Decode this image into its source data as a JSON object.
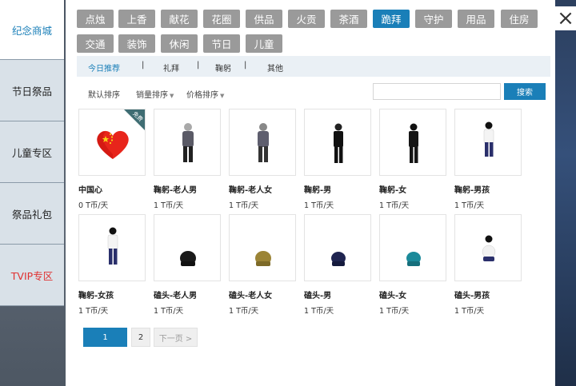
{
  "side_nav": [
    {
      "label": "纪念商城",
      "active": true
    },
    {
      "label": "节日祭品"
    },
    {
      "label": "儿童专区"
    },
    {
      "label": "祭品礼包"
    },
    {
      "label": "TVIP专区",
      "vip": true
    }
  ],
  "categories": [
    {
      "label": "点烛"
    },
    {
      "label": "上香"
    },
    {
      "label": "献花"
    },
    {
      "label": "花圈"
    },
    {
      "label": "供品"
    },
    {
      "label": "火贡"
    },
    {
      "label": "茶酒"
    },
    {
      "label": "跪拜",
      "active": true
    },
    {
      "label": "守护"
    },
    {
      "label": "用品"
    },
    {
      "label": "住房"
    },
    {
      "label": "交通"
    },
    {
      "label": "装饰"
    },
    {
      "label": "休闲"
    },
    {
      "label": "节日"
    },
    {
      "label": "儿童"
    }
  ],
  "subtabs": [
    {
      "label": "今日推荐",
      "active": true
    },
    {
      "label": "礼拜"
    },
    {
      "label": "鞠躬"
    },
    {
      "label": "其他"
    }
  ],
  "subtab_separator": "|",
  "sort": {
    "default": "默认排序",
    "sales": "销量排序",
    "price": "价格排序",
    "caret": "▼"
  },
  "search": {
    "value": "",
    "placeholder": "",
    "button": "搜索"
  },
  "products": [
    {
      "name": "中国心",
      "price": "0 T币/天",
      "badge": "免费",
      "image": "heart-flag"
    },
    {
      "name": "鞠躬-老人男",
      "price": "1 T币/天",
      "image": "figure-elder-man"
    },
    {
      "name": "鞠躬-老人女",
      "price": "1 T币/天",
      "image": "figure-elder-woman"
    },
    {
      "name": "鞠躬-男",
      "price": "1 T币/天",
      "image": "figure-man"
    },
    {
      "name": "鞠躬-女",
      "price": "1 T币/天",
      "image": "figure-woman"
    },
    {
      "name": "鞠躬-男孩",
      "price": "1 T币/天",
      "image": "figure-boy"
    },
    {
      "name": "鞠躬-女孩",
      "price": "1 T币/天",
      "image": "figure-girl"
    },
    {
      "name": "磕头-老人男",
      "price": "1 T币/天",
      "image": "kneel-elder-man"
    },
    {
      "name": "磕头-老人女",
      "price": "1 T币/天",
      "image": "kneel-elder-woman"
    },
    {
      "name": "磕头-男",
      "price": "1 T币/天",
      "image": "kneel-man"
    },
    {
      "name": "磕头-女",
      "price": "1 T币/天",
      "image": "kneel-woman"
    },
    {
      "name": "磕头-男孩",
      "price": "1 T币/天",
      "image": "kneel-boy"
    }
  ],
  "pager": {
    "current": "1",
    "page2": "2",
    "next": "下一页 >"
  },
  "close_icon": "×",
  "colors": {
    "accent": "#1a7fb8",
    "category_bg": "#9a9a9a",
    "vip": "#e03030"
  }
}
